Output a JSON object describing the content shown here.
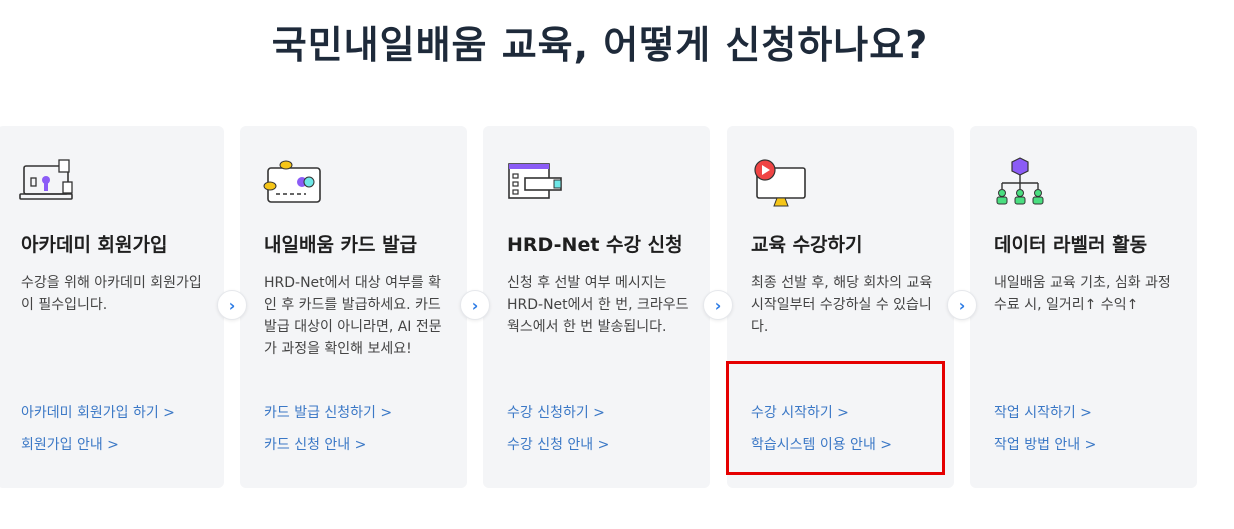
{
  "page": {
    "title": "국민내일배움 교육, 어떻게 신청하나요?"
  },
  "cards": [
    {
      "icon": "academy-signup-icon",
      "title": "아카데미 회원가입",
      "desc": "수강을 위해 아카데미 회원가입이 필수입니다.",
      "links": [
        "아카데미 회원가입 하기 >",
        "회원가입 안내 >"
      ]
    },
    {
      "icon": "card-issue-icon",
      "title": "내일배움 카드 발급",
      "desc": "HRD-Net에서 대상 여부를 확인 후 카드를 발급하세요. 카드발급 대상이 아니라면, AI 전문가 과정을 확인해 보세요!",
      "links": [
        "카드 발급 신청하기 >",
        "카드 신청 안내 >"
      ]
    },
    {
      "icon": "hrd-net-apply-icon",
      "title": "HRD-Net 수강 신청",
      "desc": "신청 후 선발 여부 메시지는 HRD-Net에서 한 번, 크라우드웍스에서 한 번 발송됩니다.",
      "links": [
        "수강 신청하기 >",
        "수강 신청 안내 >"
      ]
    },
    {
      "icon": "video-monitor-icon",
      "title": "교육 수강하기",
      "desc": "최종 선발 후, 해당 회차의 교육 시작일부터 수강하실 수 있습니다.",
      "links": [
        "수강 시작하기 >",
        "학습시스템 이용 안내 >"
      ]
    },
    {
      "icon": "data-network-icon",
      "title": "데이터 라벨러 활동",
      "desc": "내일배움 교육 기초, 심화 과정 수료 시, 일거리↑ 수익↑",
      "links": [
        "작업 시작하기 >",
        "작업 방법 안내 >"
      ]
    }
  ],
  "arrow": {
    "glyph": "›",
    "icon": "chevron-right-icon"
  },
  "colors": {
    "link": "#3b78c6",
    "arrow": "#2c7be5",
    "highlight": "#e50000",
    "card_bg": "#f4f5f7"
  }
}
